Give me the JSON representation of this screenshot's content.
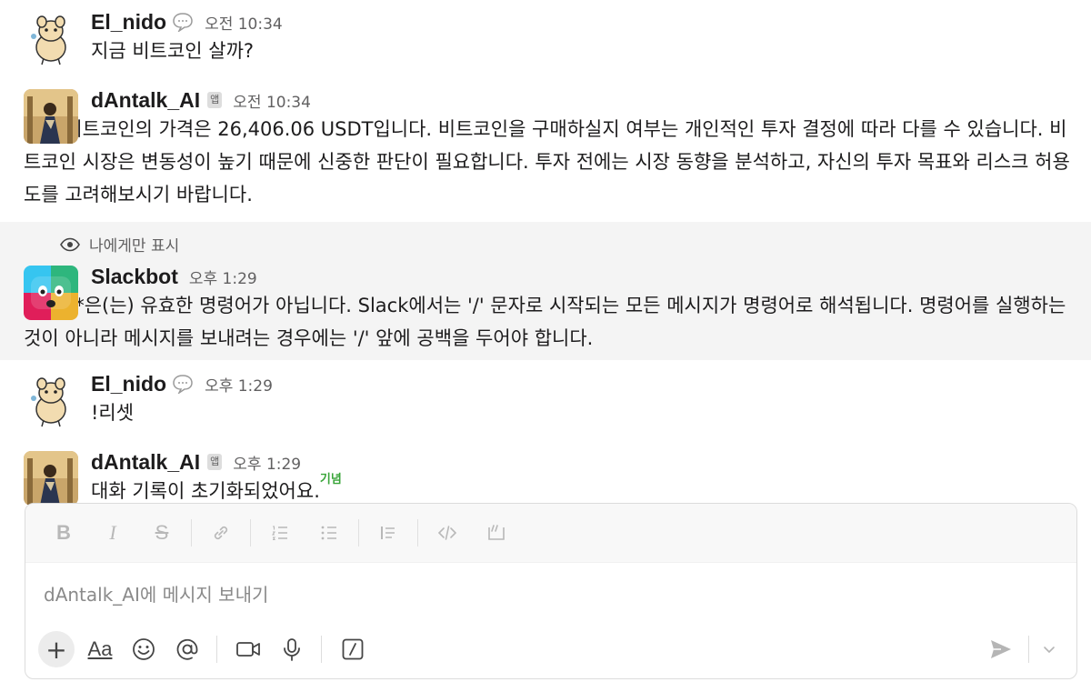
{
  "messages": [
    {
      "author": "El_nido",
      "time": "오전 10:34",
      "text": "지금 비트코인 살까?"
    },
    {
      "author": "dAntalk_AI",
      "badge": "앱",
      "time": "오전 10:34",
      "text": "현재 비트코인의 가격은 26,406.06 USDT입니다. 비트코인을 구매하실지 여부는 개인적인 투자 결정에 따라 다를 수 있습니다. 비트코인 시장은 변동성이 높기 때문에 신중한 판단이 필요합니다. 투자 전에는 시장 동향을 분석하고, 자신의 투자 목표와 리스크 허용도를 고려해보시기 바랍니다."
    },
    {
      "visibility_note": "나에게만 표시",
      "author": "Slackbot",
      "time": "오후 1:29",
      "text": "*/리셋*은(는) 유효한 명령어가 아닙니다. Slack에서는 '/' 문자로 시작되는 모든 메시지가 명령어로 해석됩니다. 명령어를 실행하는 것이 아니라 메시지를 보내려는 경우에는 '/' 앞에 공백을 두어야 합니다."
    },
    {
      "author": "El_nido",
      "time": "오후 1:29",
      "text": "!리셋"
    },
    {
      "author": "dAntalk_AI",
      "badge": "앱",
      "time": "오후 1:29",
      "text": "대화 기록이 초기화되었어요.",
      "sticker_text": "기념"
    }
  ],
  "composer": {
    "placeholder": "dAntalk_AI에 메시지 보내기",
    "format_buttons": [
      "B",
      "I",
      "S"
    ],
    "aa_label": "Aa"
  },
  "icons": {
    "format": [
      "bold-icon",
      "italic-icon",
      "strikethrough-icon",
      "link-icon",
      "ordered-list-icon",
      "bulleted-list-icon",
      "blockquote-icon",
      "code-icon",
      "code-block-icon"
    ],
    "actions": [
      "plus-icon",
      "format-toggle-icon",
      "emoji-icon",
      "mention-icon",
      "video-icon",
      "microphone-icon",
      "slash-command-icon",
      "send-icon",
      "chevron-down-icon"
    ]
  },
  "colors": {
    "text": "#1d1c1d",
    "muted": "#616061",
    "highlight_bg": "#f4f4f4",
    "composer_border": "#dcdcdc"
  }
}
